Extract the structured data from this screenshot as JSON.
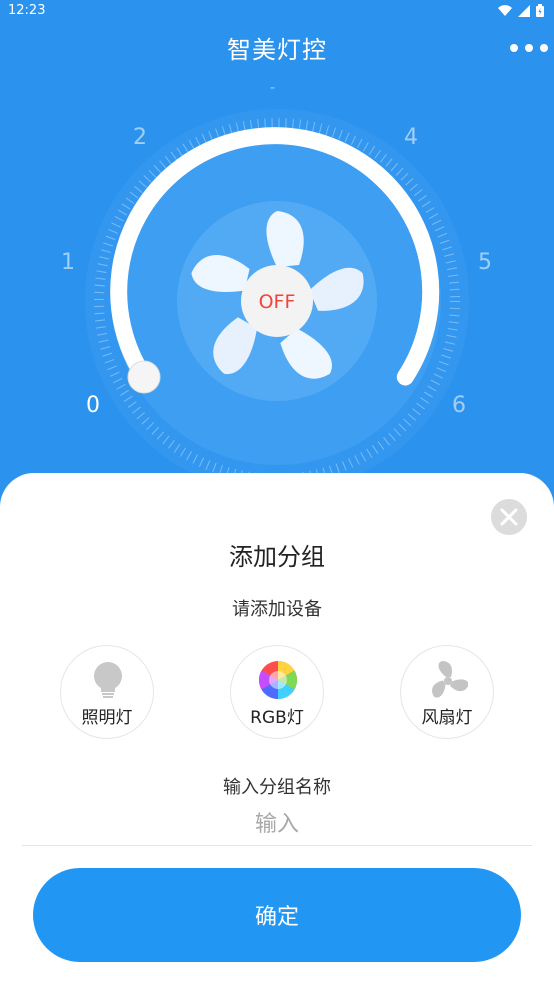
{
  "status_bar": {
    "time": "12:23"
  },
  "header": {
    "title": "智美灯控"
  },
  "dial": {
    "labels": [
      "0",
      "1",
      "2",
      "-",
      "4",
      "5",
      "6"
    ],
    "power_label": "OFF"
  },
  "sheet": {
    "title": "添加分组",
    "subtitle": "请添加设备",
    "devices": [
      {
        "label": "照明灯",
        "icon": "bulb-icon"
      },
      {
        "label": "RGB灯",
        "icon": "color-wheel-icon"
      },
      {
        "label": "风扇灯",
        "icon": "fan-icon"
      }
    ],
    "name_label": "输入分组名称",
    "name_placeholder": "输入",
    "confirm_label": "确定"
  },
  "colors": {
    "primary": "#2196f3",
    "header_bg": "#2b93ee",
    "power_text": "#f0453a"
  }
}
